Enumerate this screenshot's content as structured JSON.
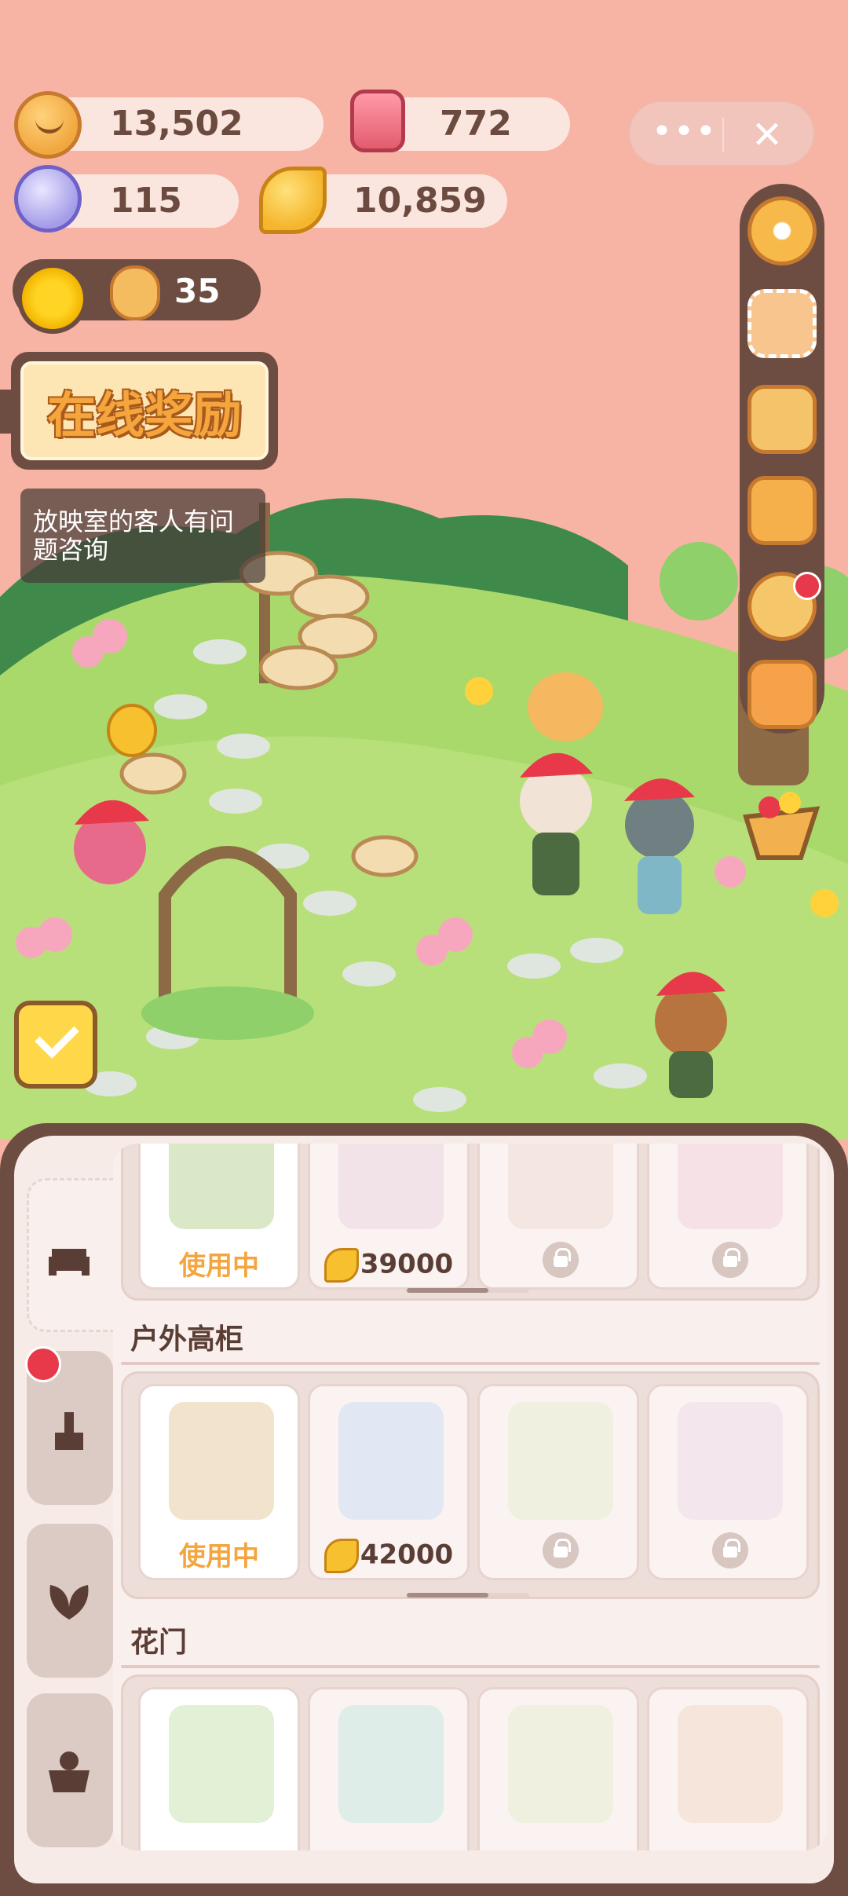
{
  "resources": {
    "cookies": "13,502",
    "candles": "772",
    "gems": "115",
    "leaves": "10,859"
  },
  "capsule": {
    "more": "•••",
    "close": "✕"
  },
  "sun_counter": {
    "count": "35"
  },
  "online_reward": {
    "title": "在线奖励"
  },
  "tip": {
    "text": "放映室的客人有问题咨询"
  },
  "icons": {
    "settings": "gear-icon",
    "photo": "photo-frame-icon",
    "star": "star-shop-icon",
    "bag": "backpack-icon",
    "friends": "friends-icon",
    "camera": "camera-icon",
    "basket": "fruit-basket-icon",
    "tasks": "task-checklist-icon"
  },
  "side_tabs": [
    {
      "name": "furniture-tab",
      "icon": "armchair-icon"
    },
    {
      "name": "decor-tab",
      "icon": "brush-icon"
    },
    {
      "name": "plants-tab",
      "icon": "leaf-icon"
    },
    {
      "name": "storage-tab",
      "icon": "bear-box-icon"
    }
  ],
  "sections": [
    {
      "title": "",
      "items": [
        {
          "status": "使用中",
          "price": "",
          "locked": false
        },
        {
          "status": "",
          "price": "39000",
          "locked": false
        },
        {
          "status": "",
          "price": "",
          "locked": true
        },
        {
          "status": "",
          "price": "",
          "locked": true
        }
      ]
    },
    {
      "title": "户外高柜",
      "items": [
        {
          "status": "使用中",
          "price": "",
          "locked": false
        },
        {
          "status": "",
          "price": "42000",
          "locked": false
        },
        {
          "status": "",
          "price": "",
          "locked": true
        },
        {
          "status": "",
          "price": "",
          "locked": true
        }
      ]
    },
    {
      "title": "花门",
      "items": [
        {
          "status": "",
          "price": "",
          "locked": false
        },
        {
          "status": "",
          "price": "",
          "locked": false
        },
        {
          "status": "",
          "price": "",
          "locked": false
        },
        {
          "status": "",
          "price": "",
          "locked": false
        }
      ]
    }
  ],
  "colors": {
    "sky": "#f7b3a3",
    "grass": "#a9d96a",
    "panel_frame": "#6d4d42",
    "accent_orange": "#f4a53d",
    "notification_red": "#e8394a"
  }
}
